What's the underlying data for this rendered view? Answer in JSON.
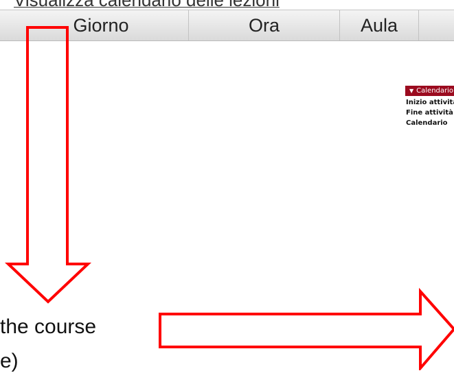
{
  "page": {
    "title": "Visualizza calendario delle lezioni"
  },
  "table": {
    "headers": [
      "Giorno",
      "Ora",
      "Aula",
      ""
    ]
  },
  "calendar_panel": {
    "header_label": "Calendario",
    "rows": [
      "Inizio attività didattiche",
      "Fine attività didattiche",
      "Calendario"
    ]
  },
  "caption": {
    "line1": "the course",
    "line2": "e)"
  },
  "colors": {
    "arrow": "#ff0000",
    "panel_header": "#9b0b1f"
  },
  "icons": {
    "down_arrow": "down-arrow-icon",
    "right_arrow": "right-arrow-icon"
  }
}
